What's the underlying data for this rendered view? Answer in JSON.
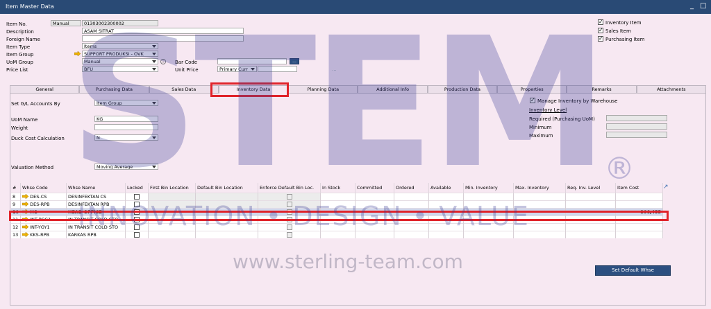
{
  "window": {
    "title": "Item Master Data",
    "minimize": "_",
    "maximize": "□"
  },
  "header": {
    "item_no_label": "Item No.",
    "item_no_series": "Manual",
    "item_no_value": "01303002300002",
    "description_label": "Description",
    "description_value": "ASAM SITRAT",
    "foreign_name_label": "Foreign Name",
    "foreign_name_value": "",
    "item_type_label": "Item Type",
    "item_type_value": "Items",
    "item_group_label": "Item Group",
    "item_group_value": "SUPPORT PRODUKSI - OVK",
    "uom_group_label": "UoM Group",
    "uom_group_value": "Manual",
    "price_list_label": "Price List",
    "price_list_value": "BFU",
    "bar_code_label": "Bar Code",
    "bar_code_value": "",
    "bar_code_btn": "...",
    "unit_price_label": "Unit Price",
    "unit_price_currency": "Primary Curr",
    "unit_price_value": "",
    "unit_price_btn": "..."
  },
  "checkboxes": [
    {
      "label": "Inventory Item",
      "checked": true
    },
    {
      "label": "Sales Item",
      "checked": true
    },
    {
      "label": "Purchasing Item",
      "checked": true
    }
  ],
  "tabs": [
    "General",
    "Purchasing Data",
    "Sales Data",
    "Inventory Data",
    "Planning Data",
    "Additional Info",
    "Production Data",
    "Properties",
    "Remarks",
    "Attachments"
  ],
  "active_tab": "Inventory Data",
  "inventory": {
    "gl_label": "Set G/L Accounts By",
    "gl_value": "Item Group",
    "uom_name_label": "UoM Name",
    "uom_name_value": "KG",
    "weight_label": "Weight",
    "weight_value": "",
    "duck_label": "Duck Cost Calculation",
    "duck_value": "N",
    "valuation_label": "Valuation Method",
    "valuation_value": "Moving Average",
    "manage_by_wh_label": "Manage Inventory by Warehouse",
    "manage_by_wh_checked": true,
    "inv_level_label": "Inventory Level",
    "required_label": "Required (Purchasing UoM)",
    "minimum_label": "Minimum",
    "maximum_label": "Maximum"
  },
  "grid": {
    "columns": [
      "#",
      "Whse Code",
      "Whse Name",
      "Locked",
      "First Bin Location",
      "Default Bin Location",
      "Enforce Default Bin Loc.",
      "In Stock",
      "Committed",
      "Ordered",
      "Available",
      "Min. Inventory",
      "Max. Inventory",
      "Req. Inv. Level",
      "Item Cost"
    ],
    "rows": [
      {
        "num": "8",
        "code": "DES-CS",
        "name": "DESINFEKTAN CS",
        "cost": ""
      },
      {
        "num": "9",
        "code": "DES-RPB",
        "name": "DESINFEKTAN RPB",
        "cost": ""
      },
      {
        "num": "10",
        "code": "HO",
        "name": "HEAD OFFICE",
        "cost": "306,455"
      },
      {
        "num": "11",
        "code": "INT-PCG1",
        "name": "IN TRANSIT COLD STO",
        "cost": ""
      },
      {
        "num": "12",
        "code": "INT-YGY1",
        "name": "IN TRANSIT COLD STO",
        "cost": ""
      },
      {
        "num": "13",
        "code": "KKS-RPB",
        "name": "KARKAS RPB",
        "cost": ""
      }
    ],
    "selected_row": 2
  },
  "set_default_btn": "Set Default Whse",
  "watermark": {
    "logo": "STEM",
    "registered": "®",
    "tagline": "INNOVATION • DESIGN • VALUE",
    "url": "www.sterling-team.com"
  },
  "colors": {
    "titlebar": "#294a75",
    "highlight": "#e0232a",
    "arrow": "#f0b400"
  }
}
